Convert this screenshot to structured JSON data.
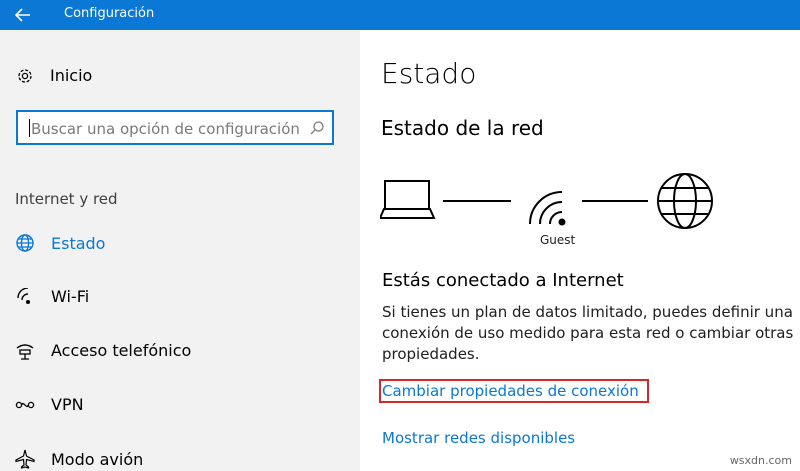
{
  "window": {
    "title": "Configuración"
  },
  "sidebar": {
    "home_label": "Inicio",
    "search_placeholder": "Buscar una opción de configuración",
    "section_title": "Internet y red",
    "items": [
      {
        "label": "Estado",
        "icon": "globe-icon",
        "active": true
      },
      {
        "label": "Wi-Fi",
        "icon": "wifi-icon",
        "active": false
      },
      {
        "label": "Acceso telefónico",
        "icon": "dialup-icon",
        "active": false
      },
      {
        "label": "VPN",
        "icon": "vpn-icon",
        "active": false
      },
      {
        "label": "Modo avión",
        "icon": "airplane-icon",
        "active": false
      }
    ]
  },
  "main": {
    "title": "Estado",
    "subtitle": "Estado de la red",
    "network_name": "Guest",
    "status_title": "Estás conectado a Internet",
    "description_lines": [
      "Si tienes un plan de datos limitado, puedes definir una",
      "conexión de uso medido para esta red o cambiar otras",
      "propiedades."
    ],
    "change_link": "Cambiar propiedades de conexión",
    "show_networks_link": "Mostrar redes disponibles"
  },
  "watermark": "wsxdn.com",
  "colors": {
    "accent": "#0a78d4",
    "highlight": "#d8262b",
    "sidebar_bg": "#f2f2f2"
  }
}
